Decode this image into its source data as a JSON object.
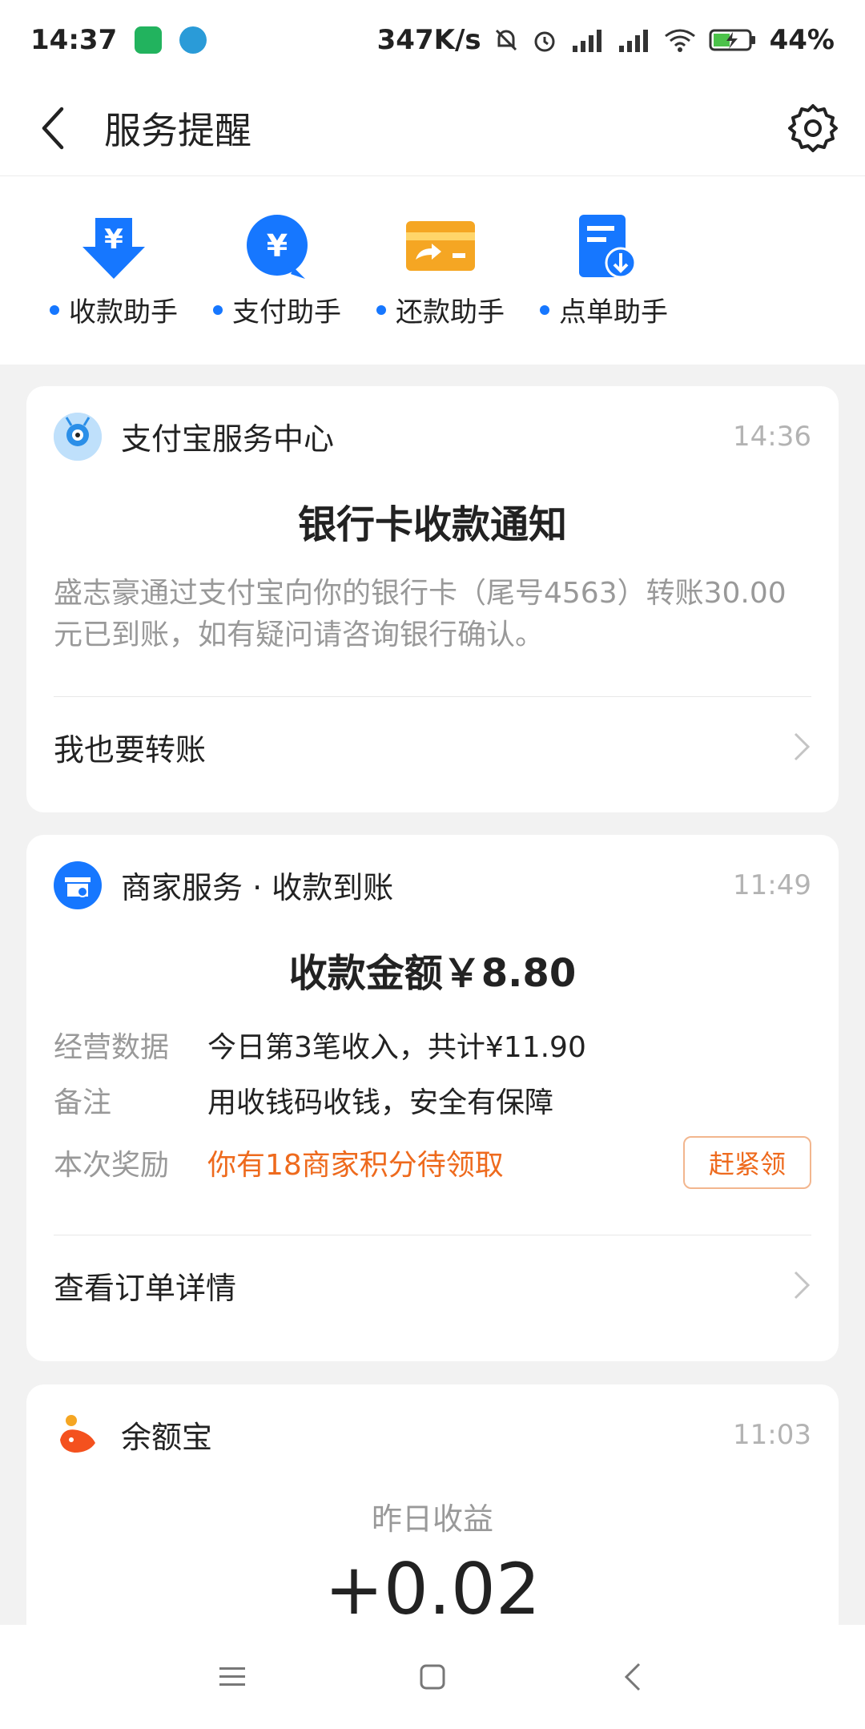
{
  "status_bar": {
    "time": "14:37",
    "network_speed": "347K/s",
    "battery": "44%",
    "icons": [
      "shield-app-icon",
      "telegram-icon",
      "mute-bell-icon",
      "alarm-icon",
      "signal-hd-icon",
      "signal-hd-icon",
      "wifi-icon",
      "battery-charging-icon"
    ]
  },
  "header": {
    "title": "服务提醒",
    "back_icon": "chevron-left-icon",
    "settings_icon": "gear-icon"
  },
  "helpers": [
    {
      "label": "收款助手",
      "icon": "receive-money-icon",
      "color": "#1677ff"
    },
    {
      "label": "支付助手",
      "icon": "pay-yuan-icon",
      "color": "#1677ff"
    },
    {
      "label": "还款助手",
      "icon": "repay-card-icon",
      "color": "#f5a623"
    },
    {
      "label": "点单助手",
      "icon": "order-doc-icon",
      "color": "#1677ff"
    }
  ],
  "cards": [
    {
      "source": "支付宝服务中心",
      "time": "14:36",
      "title": "银行卡收款通知",
      "body": "盛志豪通过支付宝向你的银行卡（尾号4563）转账30.00元已到账，如有疑问请咨询银行确认。",
      "link": "我也要转账"
    },
    {
      "source": "商家服务 · 收款到账",
      "time": "11:49",
      "title": "收款金额￥8.80",
      "rows": [
        {
          "key": "经营数据",
          "value": "今日第3笔收入，共计¥11.90"
        },
        {
          "key": "备注",
          "value": "用收钱码收钱，安全有保障"
        },
        {
          "key": "本次奖励",
          "value": "你有18商家积分待领取",
          "button": "赶紧领"
        }
      ],
      "link": "查看订单详情"
    },
    {
      "source": "余额宝",
      "time": "11:03",
      "subtitle": "昨日收益",
      "amount": "+0.02"
    }
  ],
  "colors": {
    "accent_blue": "#1677ff",
    "accent_orange": "#ee6a1d",
    "muted_text": "#999999",
    "background": "#f2f2f2"
  }
}
